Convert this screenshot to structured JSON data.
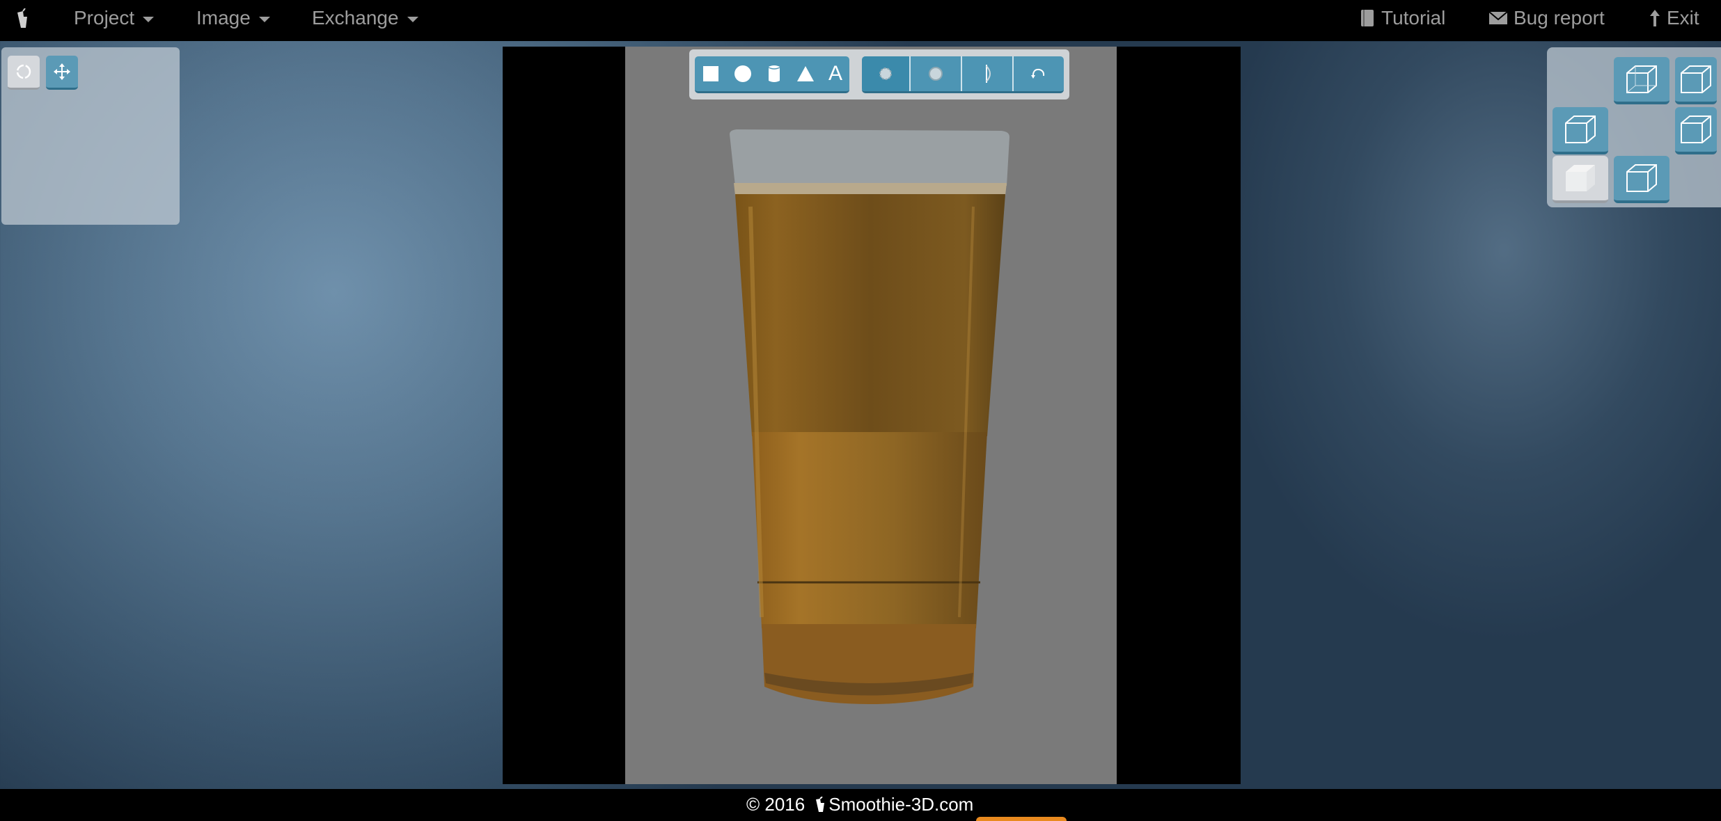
{
  "topbar": {
    "menus": [
      {
        "label": "Project"
      },
      {
        "label": "Image"
      },
      {
        "label": "Exchange"
      }
    ],
    "tutorial_label": "Tutorial",
    "bug_report_label": "Bug report",
    "exit_label": "Exit"
  },
  "left_tools": [
    {
      "icon": "rotate-circle-icon",
      "active": true
    },
    {
      "icon": "move-arrows-icon",
      "active": false
    }
  ],
  "shape_tools": [
    {
      "icon": "square-icon"
    },
    {
      "icon": "circle-icon"
    },
    {
      "icon": "cylinder-icon"
    },
    {
      "icon": "triangle-icon"
    },
    {
      "icon": "text-icon",
      "label": "A"
    }
  ],
  "edit_tools": [
    {
      "icon": "smooth-blob-icon",
      "active": true
    },
    {
      "icon": "blob-icon"
    },
    {
      "icon": "mirror-icon"
    },
    {
      "icon": "rotate-arrow-icon"
    }
  ],
  "view_cubes": [
    {
      "name": "view-top",
      "active": false
    },
    {
      "name": "view-top-right",
      "active": false
    },
    {
      "name": "view-left",
      "active": false
    },
    {
      "name": "view-right",
      "active": false
    },
    {
      "name": "view-front",
      "active": true
    },
    {
      "name": "view-back",
      "active": false
    }
  ],
  "footer": {
    "copyright": "© 2016",
    "brand": "Smoothie-3D.com"
  },
  "colors": {
    "accent": "#4d95b4",
    "footer_accent": "#e98a1f"
  }
}
